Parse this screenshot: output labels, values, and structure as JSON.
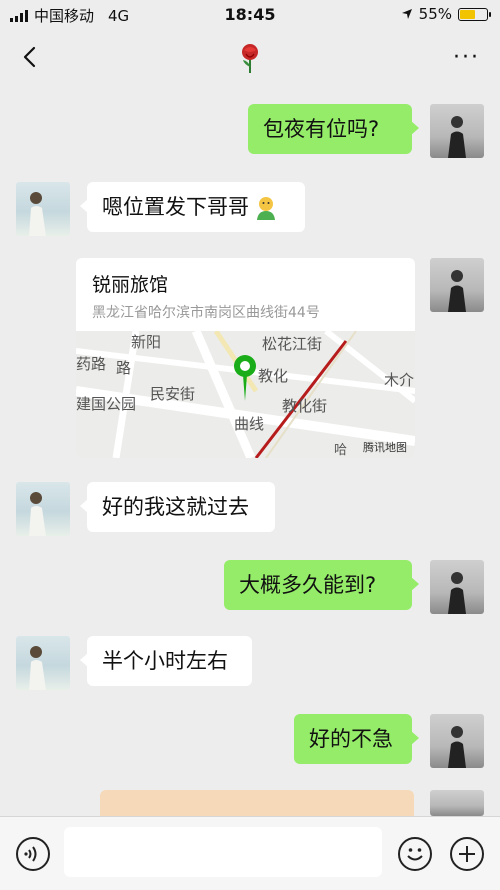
{
  "status_bar": {
    "carrier": "中国移动",
    "network": "4G",
    "time": "18:45",
    "battery": "55%",
    "battery_fraction": 0.55
  },
  "header": {
    "title_icon": "rose-icon",
    "back_icon": "back-chevron-icon",
    "more_label": "···"
  },
  "messages": [
    {
      "sender": "me",
      "text": "包夜有位吗?"
    },
    {
      "sender": "her",
      "text": "嗯位置发下哥哥",
      "emoji": "emoji-icon"
    },
    {
      "sender": "me",
      "type": "location",
      "name": "锐丽旅馆",
      "address": "黑龙江省哈尔滨市南岗区曲线街44号"
    },
    {
      "sender": "her",
      "text": "好的我这就过去"
    },
    {
      "sender": "me",
      "text": "大概多久能到?"
    },
    {
      "sender": "her",
      "text": "半个小时左右"
    },
    {
      "sender": "me",
      "text": "好的不急"
    }
  ],
  "map": {
    "labels": {
      "songhuajiang": "松花江街",
      "jiaohua": "教化",
      "xinyang": "新阳",
      "lu": "路",
      "yao": "药路",
      "jianguo": "建国公园",
      "minan": "民安街",
      "jiaohuajie": "教化街",
      "quxian": "曲线",
      "mujie": "木介",
      "ha": "哈"
    },
    "brand": "腾讯地图"
  },
  "input_bar": {
    "voice_icon": "voice-icon",
    "emoji_icon": "smile-icon",
    "plus_icon": "plus-icon"
  }
}
